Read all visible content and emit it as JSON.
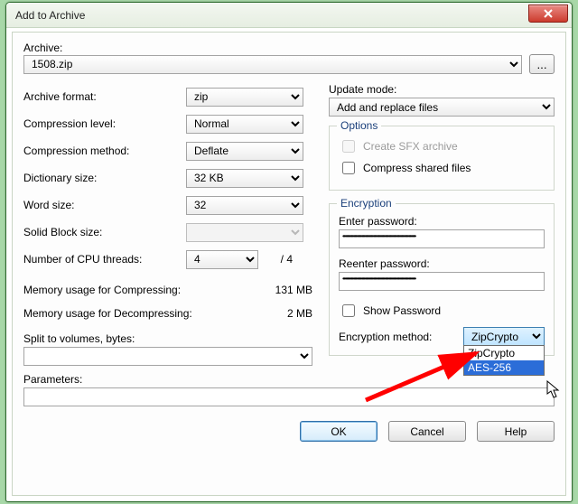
{
  "titlebar": {
    "title": "Add to Archive"
  },
  "archive": {
    "label": "Archive:",
    "value": "1508.zip",
    "browse": "..."
  },
  "left": {
    "format": {
      "label": "Archive format:",
      "value": "zip"
    },
    "level": {
      "label": "Compression level:",
      "value": "Normal"
    },
    "method": {
      "label": "Compression method:",
      "value": "Deflate"
    },
    "dict": {
      "label": "Dictionary size:",
      "value": "32 KB"
    },
    "word": {
      "label": "Word size:",
      "value": "32"
    },
    "block": {
      "label": "Solid Block size:",
      "value": ""
    },
    "threads": {
      "label": "Number of CPU threads:",
      "value": "4",
      "total": "/ 4"
    },
    "memc": {
      "label": "Memory usage for Compressing:",
      "value": "131 MB"
    },
    "memd": {
      "label": "Memory usage for Decompressing:",
      "value": "2 MB"
    },
    "split": {
      "label": "Split to volumes, bytes:",
      "value": ""
    }
  },
  "right": {
    "update": {
      "label": "Update mode:",
      "value": "Add and replace files"
    },
    "options": {
      "legend": "Options",
      "sfx": "Create SFX archive",
      "shared": "Compress shared files"
    },
    "encryption": {
      "legend": "Encryption",
      "pw_label": "Enter password:",
      "pw_mask": "••••••••••••••••••••••••••••••••••••••••••••••••••••••••••••••",
      "pw2_label": "Reenter password:",
      "pw2_mask": "••••••••••••••••••••••••••••••••••••••••••••••••••••••••••••••",
      "show": "Show Password",
      "method_label": "Encryption method:",
      "method_value": "ZipCrypto",
      "options": [
        "ZipCrypto",
        "AES-256"
      ]
    }
  },
  "params": {
    "label": "Parameters:",
    "value": ""
  },
  "buttons": {
    "ok": "OK",
    "cancel": "Cancel",
    "help": "Help"
  }
}
